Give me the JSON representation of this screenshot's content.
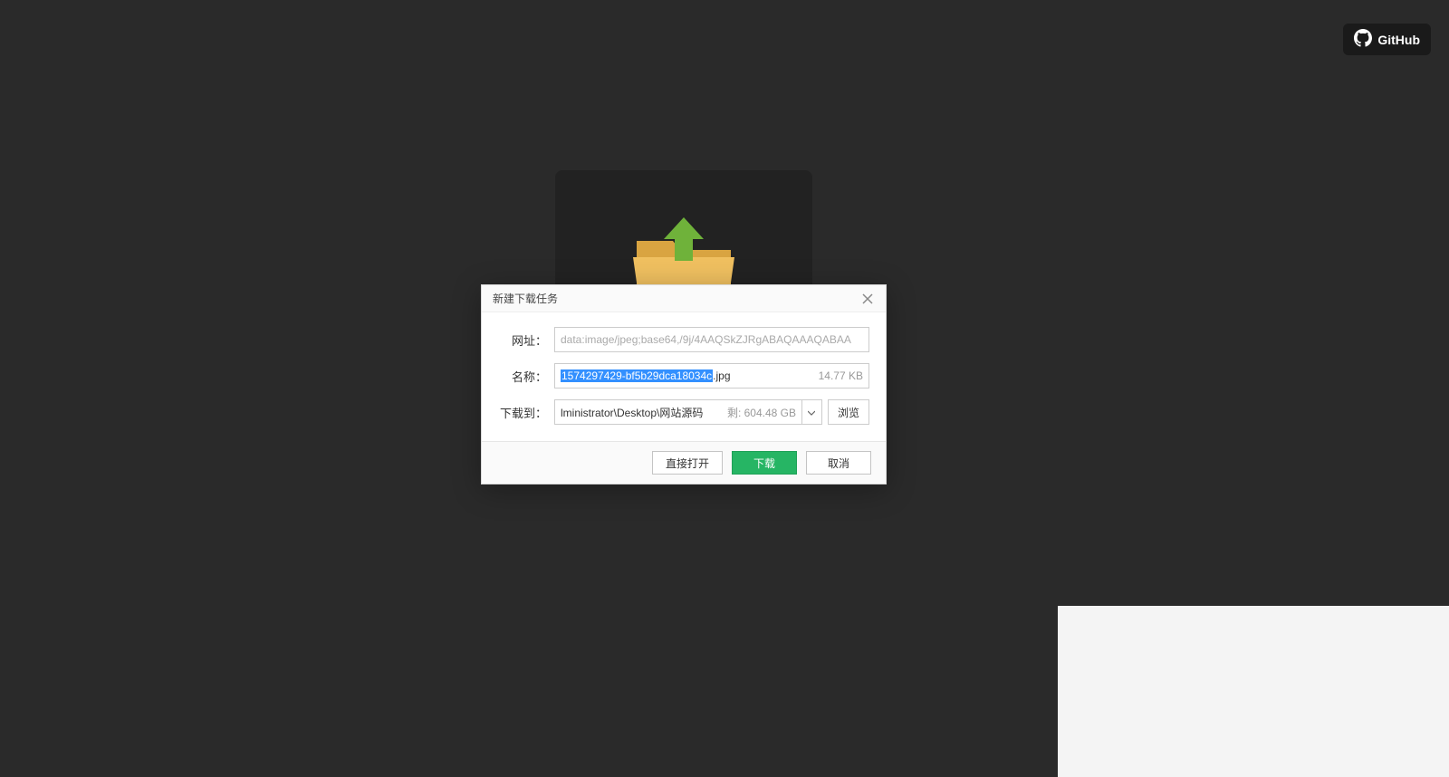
{
  "github": {
    "label": "GitHub"
  },
  "dialog": {
    "title": "新建下载任务",
    "rows": {
      "url_label": "网址：",
      "url_value": "data:image/jpeg;base64,/9j/4AAQSkZJRgABAQAAAQABAA",
      "name_label": "名称：",
      "name_selected": "1574297429-bf5b29dca18034c",
      "name_ext": ".jpg",
      "name_size": "14.77 KB",
      "dest_label": "下载到：",
      "dest_path": "lministrator\\Desktop\\网站源码",
      "dest_free": "剩: 604.48 GB",
      "browse": "浏览"
    },
    "footer": {
      "open": "直接打开",
      "download": "下载",
      "cancel": "取消"
    }
  }
}
